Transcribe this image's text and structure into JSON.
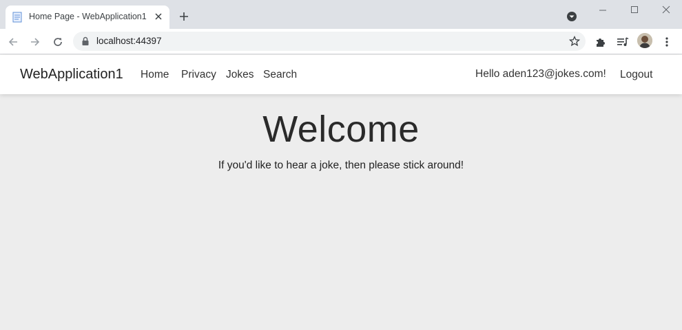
{
  "browser": {
    "tab_title": "Home Page - WebApplication1",
    "url": "localhost:44397",
    "icons": [
      "document-icon",
      "close-icon",
      "plus-icon",
      "tab-search-icon",
      "minimize-icon",
      "maximize-icon",
      "window-close-icon",
      "back-icon",
      "forward-icon",
      "reload-icon",
      "lock-icon",
      "star-icon",
      "extensions-icon",
      "reading-list-icon",
      "profile-avatar",
      "menu-icon"
    ]
  },
  "navbar": {
    "brand": "WebApplication1",
    "links": [
      "Home",
      "Privacy",
      "Jokes",
      "Search"
    ],
    "hello": "Hello aden123@jokes.com!",
    "logout": "Logout"
  },
  "main": {
    "heading": "Welcome",
    "tagline": "If you'd like to hear a joke, then please stick around!"
  },
  "colors": {
    "page_background": "#ededed",
    "navbar_background": "#ffffff",
    "tabstrip": "#dee1e6"
  }
}
